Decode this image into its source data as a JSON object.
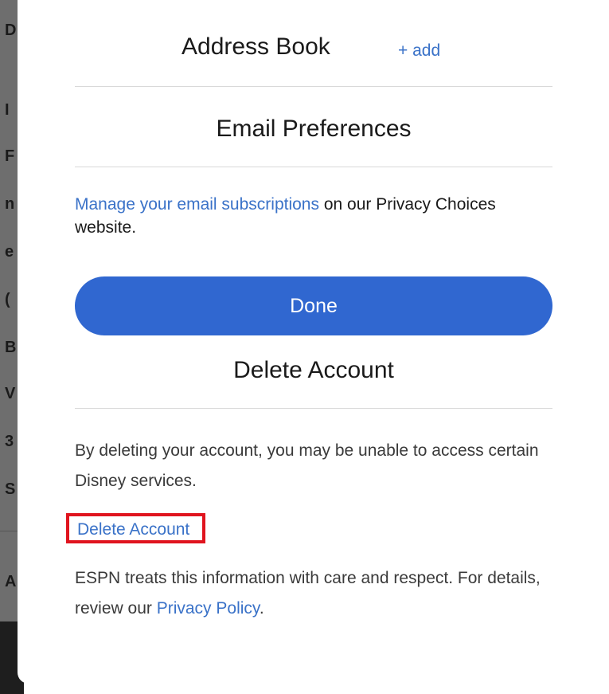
{
  "backdrop": {
    "fragments": [
      "D",
      "I",
      "F",
      "n",
      "e",
      "(",
      "B",
      "V",
      "3",
      "S",
      "A"
    ]
  },
  "address_book": {
    "title": "Address Book",
    "add_label": "+ add"
  },
  "email_preferences": {
    "title": "Email Preferences",
    "manage_link": "Manage your email subscriptions",
    "manage_suffix": " on our Privacy Choices website."
  },
  "done_button": {
    "label": "Done"
  },
  "delete_account": {
    "title": "Delete Account",
    "warning": "By deleting your account, you may be unable to access certain Disney services.",
    "link_label": "Delete Account"
  },
  "privacy": {
    "text_before": "ESPN treats this information with care and respect. For details, review our ",
    "link_label": "Privacy Policy",
    "text_after": "."
  },
  "colors": {
    "accent": "#3067d0",
    "link": "#3a72c8",
    "highlight_border": "#e0141e"
  }
}
